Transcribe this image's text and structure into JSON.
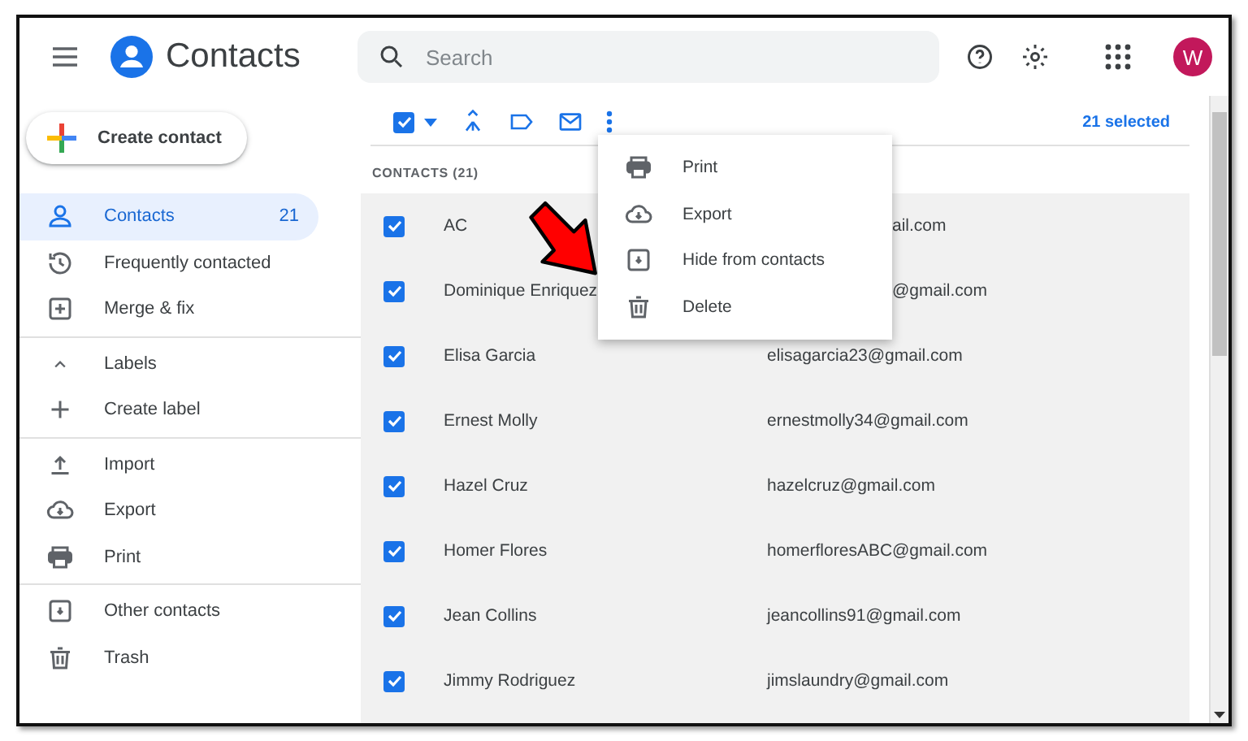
{
  "header": {
    "app_title": "Contacts",
    "search": {
      "placeholder": "Search"
    },
    "avatar": {
      "letter": "W",
      "color": "#c2185b"
    }
  },
  "sidebar": {
    "create_button": "Create contact",
    "groups": [
      {
        "items": [
          {
            "label": "Contacts",
            "count": "21",
            "selected": true
          },
          {
            "label": "Frequently contacted",
            "selected": false
          },
          {
            "label": "Merge & fix",
            "selected": false
          }
        ]
      },
      {
        "items": [
          {
            "label": "Labels",
            "expanded": true,
            "selected": false
          },
          {
            "label": "Create label",
            "selected": false
          }
        ]
      },
      {
        "items": [
          {
            "label": "Import",
            "selected": false
          },
          {
            "label": "Export",
            "selected": false
          },
          {
            "label": "Print",
            "selected": false
          }
        ]
      },
      {
        "items": [
          {
            "label": "Other contacts",
            "selected": false
          },
          {
            "label": "Trash",
            "selected": false
          }
        ]
      }
    ]
  },
  "toolbar": {
    "select_all_checked": true,
    "selected_count": "21 selected"
  },
  "list": {
    "heading": "CONTACTS (21)",
    "rows": [
      {
        "name": "AC",
        "email": "ail.com",
        "covered": true,
        "checked": true
      },
      {
        "name": "Dominique Enriquez",
        "email": "@gmail.com",
        "covered": true,
        "checked": true
      },
      {
        "name": "Elisa Garcia",
        "email": "elisagarcia23@gmail.com",
        "covered": false,
        "checked": true
      },
      {
        "name": "Ernest Molly",
        "email": "ernestmolly34@gmail.com",
        "covered": false,
        "checked": true
      },
      {
        "name": "Hazel Cruz",
        "email": "hazelcruz@gmail.com",
        "covered": false,
        "checked": true
      },
      {
        "name": "Homer Flores",
        "email": "homerfloresABC@gmail.com",
        "covered": false,
        "checked": true
      },
      {
        "name": "Jean Collins",
        "email": "jeancollins91@gmail.com",
        "covered": false,
        "checked": true
      },
      {
        "name": "Jimmy Rodriguez",
        "email": "jimslaundry@gmail.com",
        "covered": false,
        "checked": true
      }
    ]
  },
  "menu": {
    "items": [
      {
        "label": "Print"
      },
      {
        "label": "Export"
      },
      {
        "label": "Hide from contacts"
      },
      {
        "label": "Delete"
      }
    ]
  }
}
